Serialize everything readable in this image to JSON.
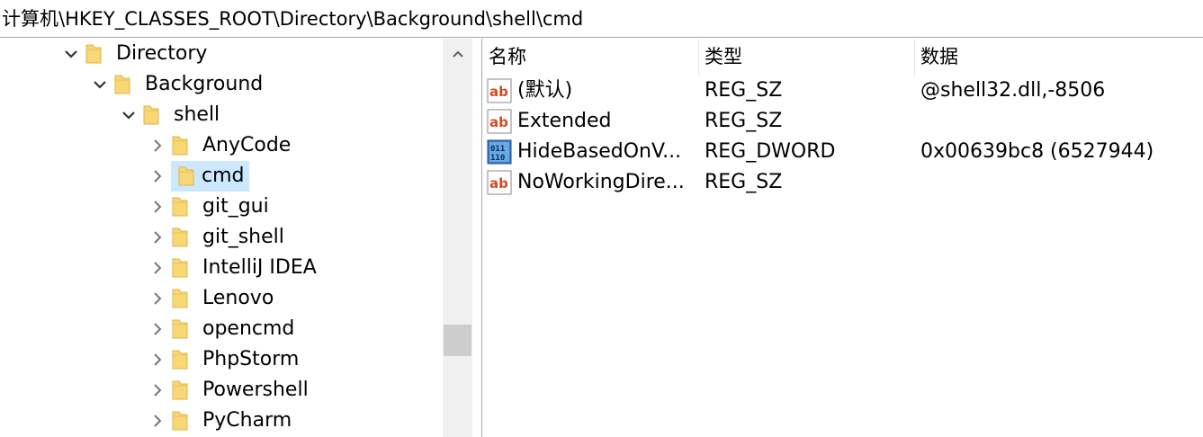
{
  "address_path": "计算机\\HKEY_CLASSES_ROOT\\Directory\\Background\\shell\\cmd",
  "tree": {
    "items": [
      {
        "label": "Directory",
        "expanded": true
      },
      {
        "label": "Background",
        "expanded": true
      },
      {
        "label": "shell",
        "expanded": true
      },
      {
        "label": "AnyCode",
        "expanded": false
      },
      {
        "label": "cmd",
        "expanded": false,
        "selected": true
      },
      {
        "label": "git_gui",
        "expanded": false
      },
      {
        "label": "git_shell",
        "expanded": false
      },
      {
        "label": "IntelliJ IDEA",
        "expanded": false
      },
      {
        "label": "Lenovo",
        "expanded": false
      },
      {
        "label": "opencmd",
        "expanded": false
      },
      {
        "label": "PhpStorm",
        "expanded": false
      },
      {
        "label": "Powershell",
        "expanded": false
      },
      {
        "label": "PyCharm",
        "expanded": false
      }
    ]
  },
  "values": {
    "columns": {
      "name": "名称",
      "type": "类型",
      "data": "数据"
    },
    "rows": [
      {
        "icon": "string-value-icon",
        "name": "(默认)",
        "type": "REG_SZ",
        "data": "@shell32.dll,-8506"
      },
      {
        "icon": "string-value-icon",
        "name": "Extended",
        "type": "REG_SZ",
        "data": ""
      },
      {
        "icon": "dword-value-icon",
        "name": "HideBasedOnV...",
        "type": "REG_DWORD",
        "data": "0x00639bc8 (6527944)"
      },
      {
        "icon": "string-value-icon",
        "name": "NoWorkingDire...",
        "type": "REG_SZ",
        "data": ""
      }
    ]
  },
  "colors": {
    "selection": "#cce8ff",
    "folder": "#f8d775",
    "scrollbar_track": "#f0f0f0",
    "scrollbar_thumb": "#cdcdcd"
  }
}
